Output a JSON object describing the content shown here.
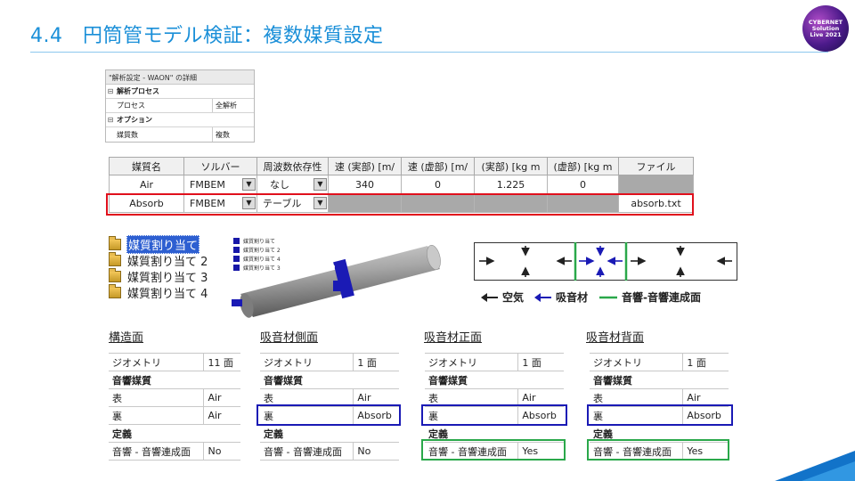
{
  "header": {
    "title": "4.4　円筒管モデル検証：複数媒質設定",
    "logo_lines": [
      "CYBERNET",
      "Solution",
      "Live 2021"
    ]
  },
  "properties_pane": {
    "title": "\"解析設定 - WAON\" の詳細",
    "sections": [
      {
        "toggle": "⊟",
        "label": "解析プロセス",
        "rows": [
          {
            "key": "プロセス",
            "value": "全解析"
          }
        ]
      },
      {
        "toggle": "⊟",
        "label": "オプション",
        "rows": [
          {
            "key": "媒質数",
            "value": "複数"
          }
        ]
      }
    ]
  },
  "media_grid": {
    "headers": [
      "媒質名",
      "ソルバー",
      "周波数依存性",
      "速 (実部) [m/",
      "速 (虚部) [m/",
      "(実部) [kg m",
      "(虚部) [kg m",
      "ファイル"
    ],
    "rows": [
      {
        "name": "Air",
        "solver": "FMBEM",
        "freq": "なし",
        "sr": "340",
        "si": "0",
        "dr": "1.225",
        "di": "0",
        "file": ""
      },
      {
        "name": "Absorb",
        "solver": "FMBEM",
        "freq": "テーブル",
        "sr": "",
        "si": "",
        "dr": "",
        "di": "",
        "file": "absorb.txt"
      }
    ],
    "dropdown_glyph": "▼"
  },
  "tree": {
    "items": [
      {
        "label": "媒質割り当て"
      },
      {
        "label": "媒質割り当て 2"
      },
      {
        "label": "媒質割り当て 3"
      },
      {
        "label": "媒質割り当て 4"
      }
    ]
  },
  "pipe_legend": {
    "items": [
      "媒質割り当て",
      "媒質割り当て 2",
      "媒質割り当て 4",
      "媒質割り当て 3"
    ]
  },
  "arrow_legend": {
    "air": "空気",
    "absorber": "吸音材",
    "interface": "音響-音響連成面",
    "colors": {
      "air": "#222222",
      "absorber": "#1a1ab5",
      "interface": "#2aa84a"
    }
  },
  "panels": [
    {
      "title": "構造面",
      "rows": [
        {
          "k": "ジオメトリ",
          "v": "11 面"
        },
        {
          "cat": "音響媒質"
        },
        {
          "k": "表",
          "v": "Air"
        },
        {
          "k": "裏",
          "v": "Air"
        },
        {
          "cat": "定義"
        },
        {
          "k": "音響 - 音響連成面",
          "v": "No"
        }
      ]
    },
    {
      "title": "吸音材側面",
      "rows": [
        {
          "k": "ジオメトリ",
          "v": "1 面"
        },
        {
          "cat": "音響媒質"
        },
        {
          "k": "表",
          "v": "Air"
        },
        {
          "k": "裏",
          "v": "Absorb"
        },
        {
          "cat": "定義"
        },
        {
          "k": "音響 - 音響連成面",
          "v": "No"
        }
      ]
    },
    {
      "title": "吸音材正面",
      "rows": [
        {
          "k": "ジオメトリ",
          "v": "1 面"
        },
        {
          "cat": "音響媒質"
        },
        {
          "k": "表",
          "v": "Air"
        },
        {
          "k": "裏",
          "v": "Absorb"
        },
        {
          "cat": "定義"
        },
        {
          "k": "音響 - 音響連成面",
          "v": "Yes"
        }
      ]
    },
    {
      "title": "吸音材背面",
      "rows": [
        {
          "k": "ジオメトリ",
          "v": "1 面"
        },
        {
          "cat": "音響媒質"
        },
        {
          "k": "表",
          "v": "Air"
        },
        {
          "k": "裏",
          "v": "Absorb"
        },
        {
          "cat": "定義"
        },
        {
          "k": "音響 - 音響連成面",
          "v": "Yes"
        }
      ]
    }
  ]
}
